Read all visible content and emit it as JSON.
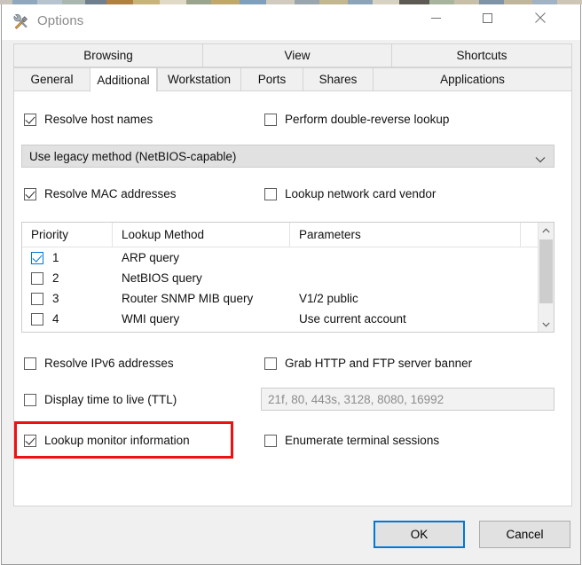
{
  "window": {
    "title": "Options",
    "icon": "tools-icon",
    "controls": {
      "minimize": "minimize-icon",
      "maximize": "maximize-icon",
      "close": "close-icon"
    }
  },
  "tabs": {
    "top_row": [
      {
        "label": "Browsing",
        "selected": false
      },
      {
        "label": "View",
        "selected": false
      },
      {
        "label": "Shortcuts",
        "selected": false
      }
    ],
    "bottom_row": [
      {
        "label": "General",
        "selected": false
      },
      {
        "label": "Additional",
        "selected": true
      },
      {
        "label": "Workstation",
        "selected": false
      },
      {
        "label": "Ports",
        "selected": false
      },
      {
        "label": "Shares",
        "selected": false
      },
      {
        "label": "Applications",
        "selected": false
      }
    ]
  },
  "page": {
    "checkboxes": {
      "resolve_host_names": {
        "label": "Resolve host names",
        "checked": true
      },
      "perform_double_reverse_lookup": {
        "label": "Perform double-reverse lookup",
        "checked": false
      },
      "resolve_mac_addresses": {
        "label": "Resolve MAC addresses",
        "checked": true
      },
      "lookup_network_card_vendor": {
        "label": "Lookup network card vendor",
        "checked": false
      },
      "resolve_ipv6_addresses": {
        "label": "Resolve IPv6 addresses",
        "checked": false
      },
      "grab_http_ftp_banner": {
        "label": "Grab HTTP and FTP server banner",
        "checked": false
      },
      "display_ttl": {
        "label": "Display time to live (TTL)",
        "checked": false
      },
      "lookup_monitor_information": {
        "label": "Lookup monitor information",
        "checked": true
      },
      "enumerate_terminal_sessions": {
        "label": "Enumerate terminal sessions",
        "checked": false
      }
    },
    "host_name_method": {
      "value": "Use legacy method (NetBIOS-capable)",
      "arrow_icon": "chevron-down-icon"
    },
    "ports_field": {
      "value": "21f, 80, 443s, 3128, 8080, 16992"
    },
    "lookup_list": {
      "columns": [
        "Priority",
        "Lookup Method",
        "Parameters"
      ],
      "rows": [
        {
          "checked": true,
          "priority": "1",
          "method": "ARP query",
          "parameters": ""
        },
        {
          "checked": false,
          "priority": "2",
          "method": "NetBIOS query",
          "parameters": ""
        },
        {
          "checked": false,
          "priority": "3",
          "method": "Router SNMP MIB query",
          "parameters": "V1/2 public"
        },
        {
          "checked": false,
          "priority": "4",
          "method": "WMI query",
          "parameters": "Use current account"
        }
      ],
      "scrollbar": {
        "up_icon": "chevron-up-icon",
        "down_icon": "chevron-down-icon"
      }
    }
  },
  "footer": {
    "ok_label": "OK",
    "cancel_label": "Cancel"
  },
  "annotation": {
    "highlight_color": "#ee1111",
    "target": "Lookup monitor information"
  },
  "colors": {
    "accent": "#0078d7",
    "window_background": "#f0f0f0",
    "panel_background": "#ffffff",
    "highlight_red": "#ee1111"
  }
}
